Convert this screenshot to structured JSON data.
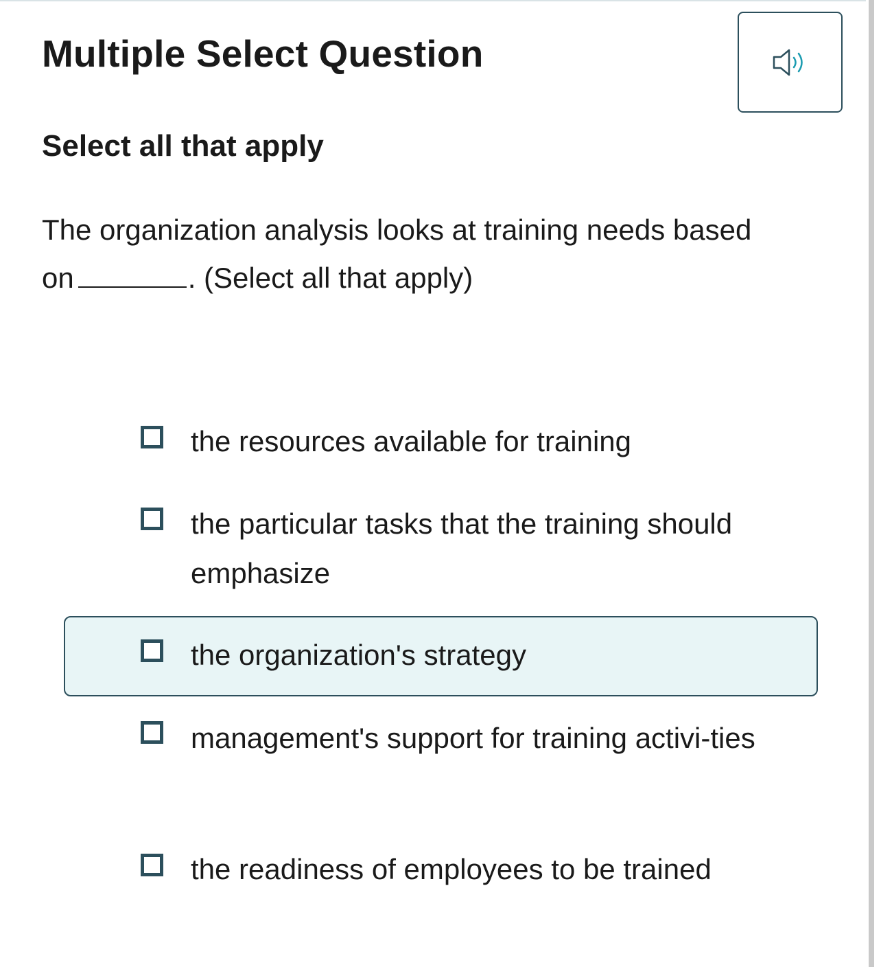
{
  "header": {
    "title": "Multiple Select Question",
    "audio_icon": "speaker-icon"
  },
  "instruction": "Select all that apply",
  "question": {
    "text_before_blank": "The organization analysis looks at training needs based on",
    "text_after_blank": ". (Select all that apply)"
  },
  "options": [
    {
      "label": "the resources available for training",
      "checked": false,
      "highlighted": false
    },
    {
      "label": "the particular tasks that the training should emphasize",
      "checked": false,
      "highlighted": false
    },
    {
      "label": "the organization's strategy",
      "checked": false,
      "highlighted": true
    },
    {
      "label": "management's support for training activi-ties",
      "checked": false,
      "highlighted": false
    },
    {
      "label": "the readiness of employees to be trained",
      "checked": false,
      "highlighted": false
    }
  ],
  "colors": {
    "accent": "#2c4f5c",
    "highlight_bg": "#e8f5f6",
    "icon_teal": "#1a9bb0"
  }
}
